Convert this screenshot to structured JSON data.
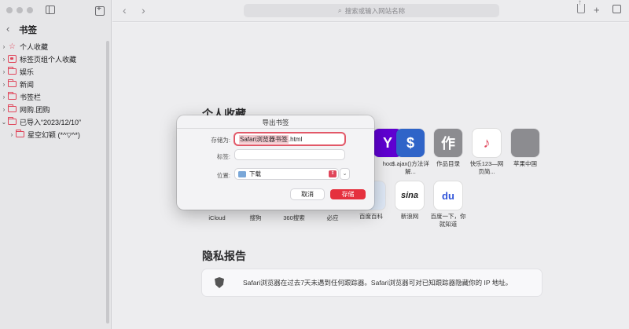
{
  "window": {
    "address_placeholder": "搜索或输入网站名称"
  },
  "sidebar": {
    "title": "书签",
    "items": [
      {
        "label": "个人收藏",
        "icon": "star-icon"
      },
      {
        "label": "标签页组个人收藏",
        "icon": "tab-group-icon"
      },
      {
        "label": "娱乐",
        "icon": "folder-icon"
      },
      {
        "label": "新闻",
        "icon": "folder-icon"
      },
      {
        "label": "书签栏",
        "icon": "folder-icon"
      },
      {
        "label": "网购.团购",
        "icon": "folder-icon"
      },
      {
        "label": "已导入“2023/12/10”",
        "icon": "folder-icon",
        "expanded": true
      },
      {
        "label": "星空幻颖 (*^▽^*)",
        "icon": "folder-icon",
        "indent": true
      }
    ]
  },
  "main": {
    "favorites_title": "个人收藏",
    "favorites_row1": [
      {
        "label": "hoo",
        "tile": "Y",
        "color": "#5f01d1"
      },
      {
        "label": "$.ajax()方法详解...",
        "tile": "$",
        "color": "#2f64c8"
      },
      {
        "label": "作品目录",
        "tile": "作",
        "color": "#8c8c90"
      },
      {
        "label": "快乐123—网页简...",
        "tile": "♪",
        "color": "#f2f2f2"
      },
      {
        "label": "苹果中国",
        "tile": "",
        "color": "#8c8c90"
      }
    ],
    "favorites_row2": [
      {
        "label": "iCloud"
      },
      {
        "label": "搜狗"
      },
      {
        "label": "360搜索"
      },
      {
        "label": "必应"
      },
      {
        "label": "百度百科"
      },
      {
        "label": "新浪网",
        "tile": "sina"
      },
      {
        "label": "百度一下，你就知道",
        "tile": "du"
      }
    ],
    "privacy_title": "隐私报告",
    "privacy_text": "Safari浏览器在过去7天未遇到任何跟踪器。Safari浏览器可对已知跟踪器隐藏你的 IP 地址。"
  },
  "dialog": {
    "title": "导出书签",
    "save_as_label": "存储为:",
    "save_as_selected": "Safari浏览器书签",
    "save_as_ext": ".html",
    "tags_label": "标签:",
    "location_label": "位置:",
    "location_value": "下载",
    "cancel_label": "取消",
    "save_label": "存储"
  }
}
